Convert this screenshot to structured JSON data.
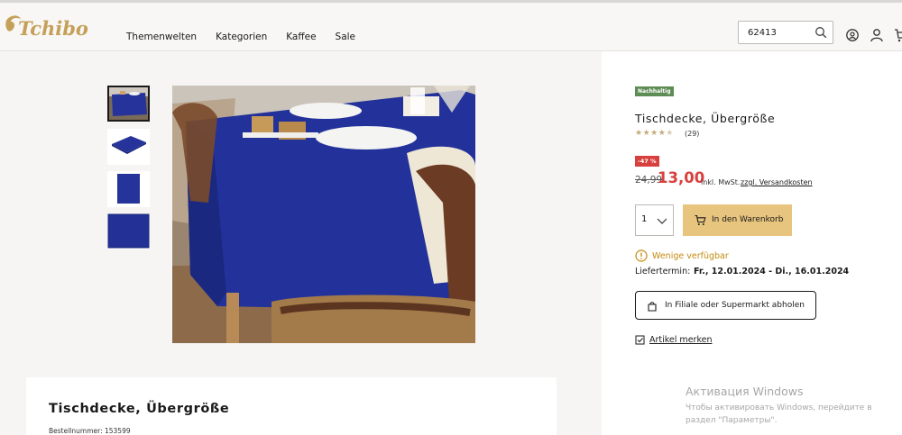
{
  "header": {
    "logo": "Tchibo",
    "nav": [
      "Themenwelten",
      "Kategorien",
      "Kaffee",
      "Sale"
    ],
    "search_value": "62413"
  },
  "product": {
    "sustainability_badge": "Nachhaltig",
    "title": "Tischdecke, Übergröße",
    "rating": 4.5,
    "review_count": "(29)",
    "discount_badge": "-47 %",
    "old_price": "24,99",
    "new_price": "13,00",
    "vat_note": "inkl. MwSt.",
    "shipping_link": "zzgl. Versandkosten",
    "quantity": "1",
    "cart_button": "In den Warenkorb",
    "availability": "Wenige verfügbar",
    "delivery_label": "Liefertermin:",
    "delivery_value": "Fr., 12.01.2024 - Di., 16.01.2024",
    "store_button": "In Filiale oder Supermarkt abholen",
    "favorite_link": "Artikel merken"
  },
  "description": {
    "title": "Tischdecke, Übergröße",
    "order_number": "Bestellnummer: 153599"
  },
  "windows_watermark": {
    "title": "Активация Windows",
    "text": "Чтобы активировать Windows, перейдите в раздел \"Параметры\"."
  },
  "colors": {
    "accent_gold": "#e7c57e",
    "price_red": "#d8403e",
    "badge_green": "#5d8c54",
    "availability_orange": "#c48a0e",
    "tablecloth_blue": "#22329a"
  }
}
